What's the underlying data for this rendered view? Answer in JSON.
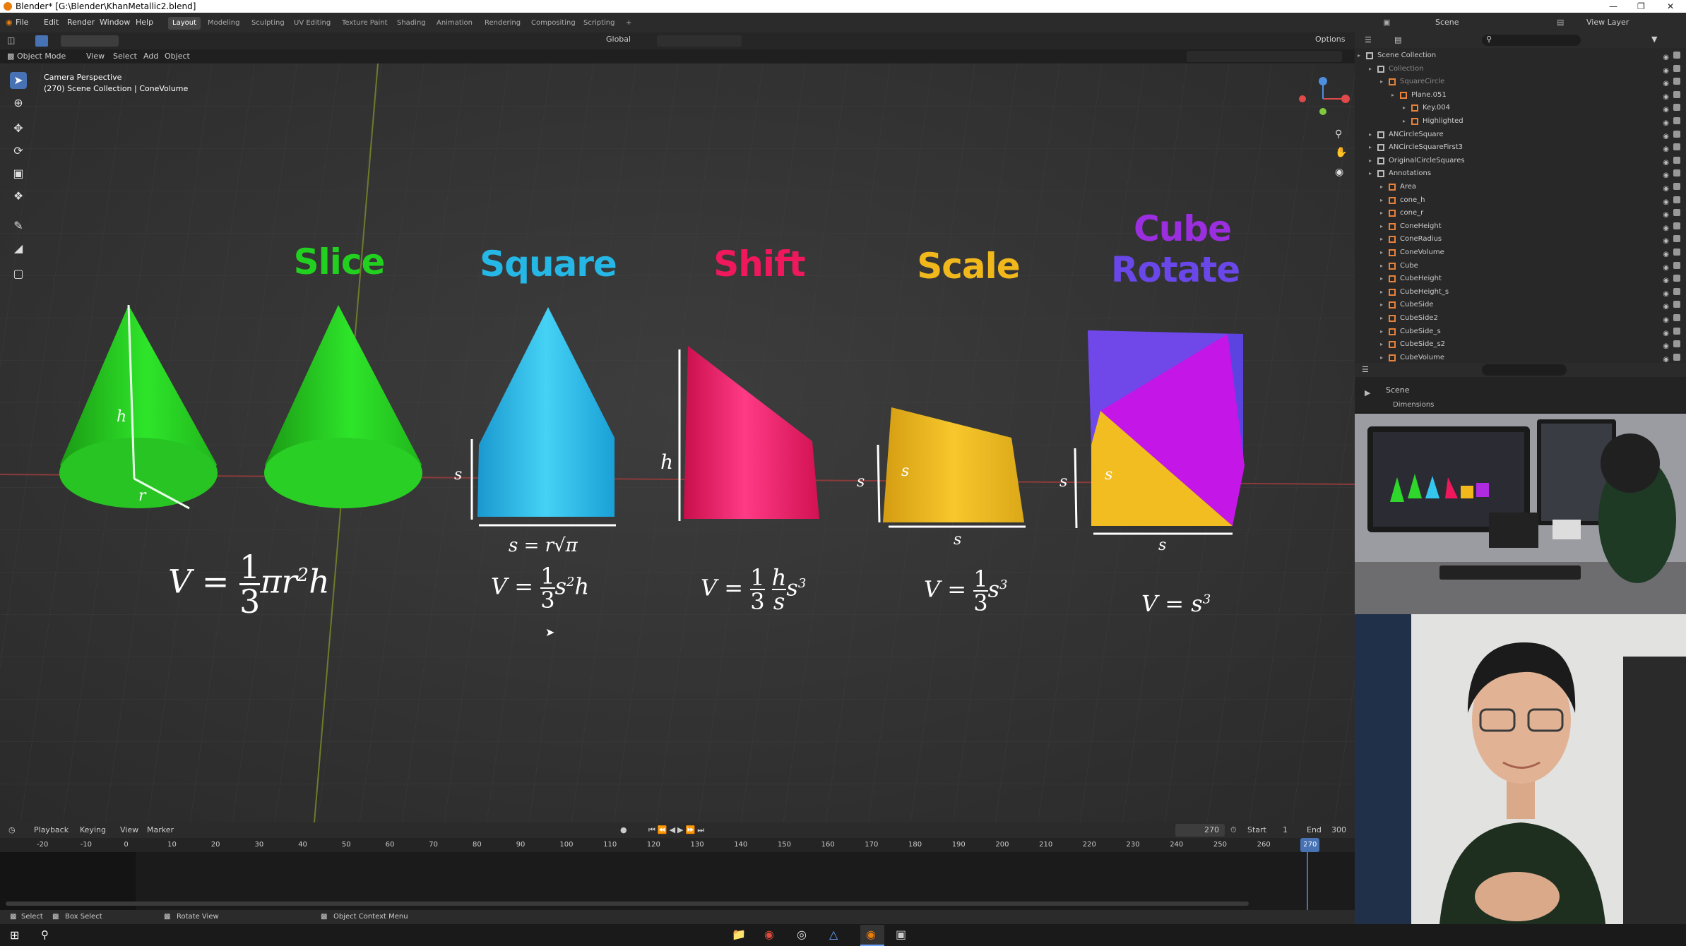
{
  "window": {
    "title": "Blender* [G:\\Blender\\KhanMetallic2.blend]"
  },
  "menu": {
    "items": [
      "File",
      "Edit",
      "Render",
      "Window",
      "Help"
    ]
  },
  "workspaces": [
    "Layout",
    "Modeling",
    "Sculpting",
    "UV Editing",
    "Texture Paint",
    "Shading",
    "Animation",
    "Rendering",
    "Compositing",
    "Scripting",
    "+"
  ],
  "active_workspace": "Layout",
  "scene_selector": {
    "scene": "Scene",
    "view_layer": "View Layer"
  },
  "viewport_header": {
    "mode": "Object Mode",
    "menus": [
      "View",
      "Select",
      "Add",
      "Object"
    ],
    "transform": "Global",
    "options": "Options"
  },
  "viewport_info": {
    "line1": "Camera Perspective",
    "line2": "(270) Scene Collection | ConeVolume"
  },
  "shapes": [
    {
      "title": "Slice",
      "color": "#22d11f",
      "formula": "V = ⅓πr²h"
    },
    {
      "title": "Square",
      "color": "#25b8e6",
      "formula": "V = ⅓s²h",
      "caption": "s = r√π"
    },
    {
      "title": "Shift",
      "color": "#f0185d",
      "formula": "V = ⅓·(h/s)·s³"
    },
    {
      "title": "Scale",
      "color": "#f1b81c",
      "formula": "V = ⅓s³"
    },
    {
      "title_line1": "Cube",
      "title_line2": "Rotate",
      "color1": "#9b2fe0",
      "color2": "#6a47e8",
      "formula": "V = s³"
    }
  ],
  "math": {
    "V": "V",
    "eq": "=",
    "one": "1",
    "three": "3",
    "pi": "π",
    "r": "r",
    "h": "h",
    "s": "s",
    "sq": "2",
    "cube": "3",
    "cap_s": "s = r",
    "cap_root": "√π"
  },
  "timeline": {
    "menus": [
      "Playback",
      "Keying",
      "View",
      "Marker"
    ],
    "current_frame": "270",
    "start_label": "Start",
    "start": "1",
    "end_label": "End",
    "end": "300",
    "ticks": [
      "-20",
      "-10",
      "0",
      "10",
      "20",
      "30",
      "40",
      "50",
      "60",
      "70",
      "80",
      "90",
      "100",
      "110",
      "120",
      "130",
      "140",
      "150",
      "160",
      "170",
      "180",
      "190",
      "200",
      "210",
      "220",
      "230",
      "240",
      "250",
      "260",
      "270"
    ]
  },
  "statusbar": {
    "items": [
      "Select",
      "Box Select",
      "Rotate View",
      "Object Context Menu"
    ]
  },
  "outliner": {
    "rows": [
      {
        "label": "Scene Collection",
        "indent": 0,
        "color": "#cccccc"
      },
      {
        "label": "Collection",
        "indent": 1,
        "color": "#888888"
      },
      {
        "label": "SquareCircle",
        "indent": 2,
        "color": "#888888"
      },
      {
        "label": "Plane.051",
        "indent": 3,
        "color": "#cccccc"
      },
      {
        "label": "Key.004",
        "indent": 4,
        "color": "#cccccc"
      },
      {
        "label": "Highlighted",
        "indent": 4,
        "color": "#cccccc"
      },
      {
        "label": "ANCircleSquare",
        "indent": 1,
        "color": "#cccccc"
      },
      {
        "label": "ANCircleSquareFirst3",
        "indent": 1,
        "color": "#cccccc"
      },
      {
        "label": "OriginalCircleSquares",
        "indent": 1,
        "color": "#cccccc"
      },
      {
        "label": "Annotations",
        "indent": 1,
        "color": "#cccccc"
      },
      {
        "label": "Area",
        "indent": 2,
        "color": "#cccccc"
      },
      {
        "label": "cone_h",
        "indent": 2,
        "color": "#cccccc"
      },
      {
        "label": "cone_r",
        "indent": 2,
        "color": "#cccccc"
      },
      {
        "label": "ConeHeight",
        "indent": 2,
        "color": "#cccccc"
      },
      {
        "label": "ConeRadius",
        "indent": 2,
        "color": "#cccccc"
      },
      {
        "label": "ConeVolume",
        "indent": 2,
        "color": "#cccccc"
      },
      {
        "label": "Cube",
        "indent": 2,
        "color": "#cccccc"
      },
      {
        "label": "CubeHeight",
        "indent": 2,
        "color": "#cccccc"
      },
      {
        "label": "CubeHeight_s",
        "indent": 2,
        "color": "#cccccc"
      },
      {
        "label": "CubeSide",
        "indent": 2,
        "color": "#cccccc"
      },
      {
        "label": "CubeSide2",
        "indent": 2,
        "color": "#cccccc"
      },
      {
        "label": "CubeSide_s",
        "indent": 2,
        "color": "#cccccc"
      },
      {
        "label": "CubeSide_s2",
        "indent": 2,
        "color": "#cccccc"
      },
      {
        "label": "CubeVolume",
        "indent": 2,
        "color": "#cccccc"
      }
    ]
  },
  "properties": {
    "scene": "Scene",
    "panel": "Dimensions"
  },
  "colors": {
    "accent": "#4772b3",
    "playhead": "#4772b3",
    "blender_orange": "#e87d0d"
  }
}
